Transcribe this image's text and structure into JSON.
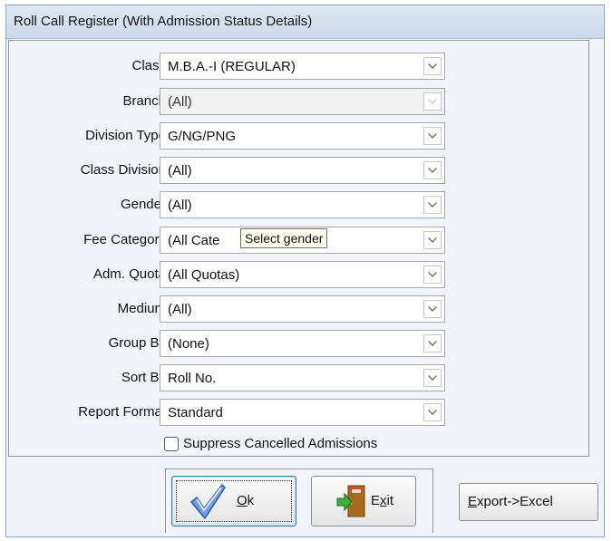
{
  "window": {
    "title": "Roll Call Register (With Admission Status Details)"
  },
  "fields": [
    {
      "label": "Class",
      "value": "M.B.A.-I (REGULAR)",
      "disabled": false
    },
    {
      "label": "Branch",
      "value": "(All)",
      "disabled": true
    },
    {
      "label": "Division Type",
      "value": "G/NG/PNG",
      "disabled": false
    },
    {
      "label": "Class Division",
      "value": "(All)",
      "disabled": false
    },
    {
      "label": "Gender",
      "value": "(All)",
      "disabled": false
    },
    {
      "label": "Fee Category",
      "value": "(All Cate",
      "disabled": false
    },
    {
      "label": "Adm. Quota",
      "value": "(All Quotas)",
      "disabled": false
    },
    {
      "label": "Medium",
      "value": "(All)",
      "disabled": false
    },
    {
      "label": "Group By",
      "value": "(None)",
      "disabled": false
    },
    {
      "label": "Sort By",
      "value": "Roll No.",
      "disabled": false
    },
    {
      "label": "Report Format",
      "value": "Standard",
      "disabled": false
    }
  ],
  "tooltip": "Select gender",
  "suppress_checkbox": {
    "label": "Suppress Cancelled Admissions",
    "checked": false
  },
  "buttons": {
    "ok": {
      "underline_char": "O",
      "rest": "k"
    },
    "exit": {
      "pre": "E",
      "underline_char": "x",
      "rest": "it"
    },
    "export": {
      "underline_char": "E",
      "rest": "xport->Excel"
    }
  },
  "icons": {
    "ok": "checkmark-icon",
    "exit": "exit-door-icon",
    "dropdown": "chevron-down-icon"
  },
  "colors": {
    "checkmark": "#2a5fb5",
    "title_bar": "#d4e0f0",
    "tooltip_bg": "#fffff0"
  }
}
